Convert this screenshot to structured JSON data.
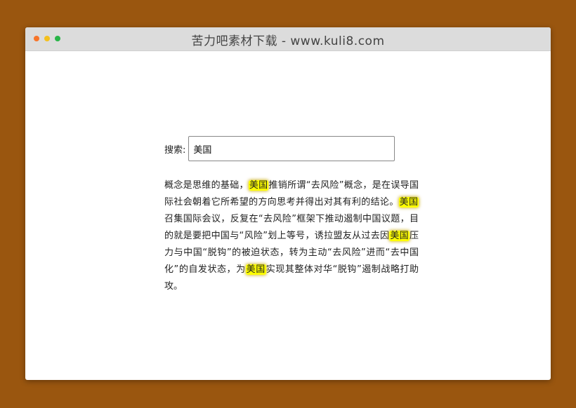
{
  "window": {
    "title": "苦力吧素材下载 - www.kuli8.com"
  },
  "search": {
    "label": "搜索:",
    "value": "美国"
  },
  "article": {
    "segments": [
      {
        "text": "概念是思维的基础，",
        "highlight": false
      },
      {
        "text": "美国",
        "highlight": true
      },
      {
        "text": "推销所谓“去风险”概念，是在误导国际社会朝着它所希望的方向思考并得出对其有利的结论。",
        "highlight": false
      },
      {
        "text": "美国",
        "highlight": true
      },
      {
        "text": "召集国际会议，反复在“去风险”框架下推动遏制中国议题，目的就是要把中国与“风险”划上等号，诱拉盟友从过去因",
        "highlight": false
      },
      {
        "text": "美国",
        "highlight": true
      },
      {
        "text": "压力与中国“脱钩”的被迫状态，转为主动“去风险”进而“去中国化”的自发状态，为",
        "highlight": false
      },
      {
        "text": "美国",
        "highlight": true
      },
      {
        "text": "实现其整体对华“脱钩”遏制战略打助攻。",
        "highlight": false
      }
    ]
  },
  "colors": {
    "background": "#9a560f",
    "highlight": "#ffff00",
    "dot_red": "#f7752a",
    "dot_yellow": "#f4c01e",
    "dot_green": "#29b548"
  }
}
